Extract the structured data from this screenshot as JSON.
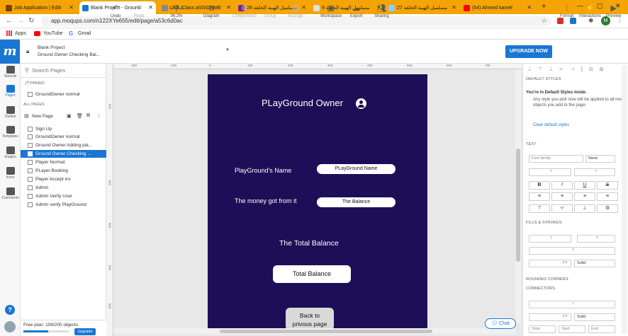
{
  "browser": {
    "tabs": [
      {
        "title": "Job Application | Editi",
        "color": "#f4a405"
      },
      {
        "title": "Blank Project - Ground",
        "color": "#1976d2"
      },
      {
        "title": "UML Class aSSIGNME",
        "color": "#888888"
      },
      {
        "title": "مسلسل الهيبة الحلقة 28",
        "color": "#7b1fa2"
      },
      {
        "title": "مسلسل الهيبة الحلقة 9",
        "color": "#e0e0e0"
      },
      {
        "title": "مسلسل الهيبة الحلقة 27",
        "color": "#90caf9"
      },
      {
        "title": "(54) Ahmed kamel",
        "color": "#ff0000"
      }
    ],
    "url": "app.moqups.com/n122XYe655/edit/page/a53c6d0ac",
    "bookmarks": [
      "Apps",
      "YouTube",
      "Gmail"
    ],
    "profile_initial": "M"
  },
  "app": {
    "project_name": "Blank Project",
    "page_name": "Ground Owner Checking Bal...",
    "toolbar": {
      "undo": "Undo",
      "redo": "Redo",
      "zoom": "96.2%",
      "diagram": "Diagram",
      "components": "Components",
      "group": "Group",
      "arrange": "Arrange",
      "workspace": "Workspace",
      "export": "Export",
      "sharing": "Sharing",
      "upgrade": "UPGRADE NOW",
      "format": "Format",
      "interactions": "Interactions",
      "preview": "Preview"
    },
    "rail": [
      "Stencils",
      "Pages",
      "Outline",
      "Templates",
      "Images",
      "Icons",
      "Comments"
    ],
    "pages_panel": {
      "search_placeholder": "Search Pages",
      "pinned_label": "PINNED",
      "pinned": [
        "GroundOwner normal"
      ],
      "all_label": "ALL PAGES",
      "new_page": "New Page",
      "pages": [
        "Sign Up",
        "GroundOwner normal",
        "Ground Owner Adding pla...",
        "Ground Owner Checking ...",
        "Player Normal",
        "PLayer Booking",
        "Player Accept inv",
        "Admin",
        "Admin Verify User",
        "Admin verify PlayGround"
      ],
      "selected_index": 3
    },
    "free_plan": {
      "text": "Free plan: 109/200 objects",
      "progress": 0.545,
      "upgrade": "Upgrade"
    },
    "ruler_top": [
      "-200",
      "-100",
      "0",
      "100",
      "200",
      "300",
      "400",
      "500",
      "600",
      "700"
    ],
    "ruler_left": [
      "100",
      "200",
      "300",
      "400",
      "500",
      "600"
    ],
    "artboard": {
      "title": "PLayGround Owner",
      "name_label": "PlayGround's Name",
      "name_field": "PLayGround Name",
      "money_label": "The money got from it",
      "balance_field": "The Balance",
      "total_label": "The Total Balance",
      "total_button": "Total Balance",
      "back_button": "Back to\nprivous page"
    },
    "chat": "Chat",
    "right_panel": {
      "default_styles": "DEFAULT STYLES",
      "info_title": "You're in Default Styles mode.",
      "info_body": "Any style you pick now will be applied to all new objects you add to the page.",
      "clear_link": "Clear default styles",
      "text": "TEXT",
      "font_family": "Font family",
      "font_weight": "None",
      "fills": "FILLS & STROKES",
      "solid": "Solid",
      "pt": "PT",
      "rounded": "ROUNDED CORNERS",
      "connectors": "CONNECTORS",
      "style": "Style",
      "start": "Start",
      "end": "End",
      "q": "?"
    }
  }
}
